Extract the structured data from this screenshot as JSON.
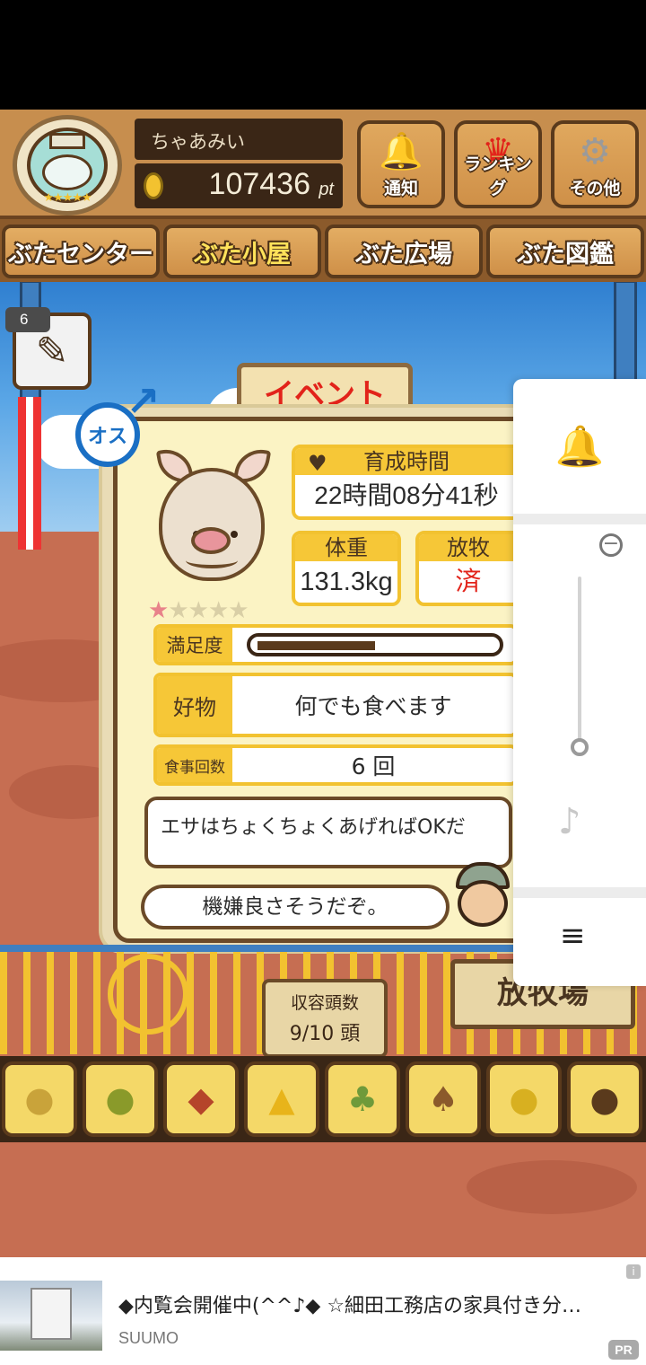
{
  "header": {
    "player_name": "ちゃあみい",
    "points_value": "107436",
    "points_unit": "pt",
    "buttons": [
      {
        "label": "通知",
        "icon": "bell-icon"
      },
      {
        "label": "ランキング",
        "icon": "crown-icon"
      },
      {
        "label": "その他",
        "icon": "gear-icon"
      }
    ]
  },
  "tabs": [
    {
      "label": "ぶたセンター"
    },
    {
      "label": "ぶた小屋"
    },
    {
      "label": "ぶた広場"
    },
    {
      "label": "ぶた図鑑"
    }
  ],
  "active_tab_index": 1,
  "item_badge": {
    "count": "6",
    "icon": "syringe-icon"
  },
  "event_sign": "イベント",
  "pig_card": {
    "gender_label": "オス",
    "rating_stars": 1,
    "rating_max": 5,
    "growth_time_label": "育成時間",
    "growth_time_value": "22時間08分41秒",
    "weight_label": "体重",
    "weight_value": "131.3kg",
    "grazing_label": "放牧",
    "grazing_value": "済",
    "satisfaction_label": "満足度",
    "satisfaction_level": 0.5,
    "favorite_label": "好物",
    "favorite_value": "何でも食べます",
    "meals_label": "食事回数",
    "meals_value": "6 回",
    "advice_text": "エサはちょくちょくあげればOKだ",
    "mood_text": "機嫌良さそうだぞ。"
  },
  "capacity": {
    "label": "収容頭数",
    "value": "9/10 頭"
  },
  "ranch_sign": "放牧場",
  "foods": [
    {
      "icon": "grain-icon"
    },
    {
      "icon": "grain-mix-icon"
    },
    {
      "icon": "sweet-potato-icon"
    },
    {
      "icon": "corn-icon"
    },
    {
      "icon": "soybean-icon"
    },
    {
      "icon": "acorn-icon"
    },
    {
      "icon": "corn-plate-icon"
    },
    {
      "icon": "meatball-plate-icon"
    }
  ],
  "ad": {
    "title": "◆内覧会開催中(^^♪◆ ☆細田工務店の家具付き分…",
    "source": "SUUMO",
    "badge": "PR"
  },
  "colors": {
    "wood": "#d9a15c",
    "dark_wood": "#5a3a1c",
    "card_bg": "#fbf3c4",
    "label_yellow": "#f6c737",
    "accent_red": "#e2231a",
    "sky_blue": "#5aa6e6",
    "ground": "#c66e52"
  }
}
